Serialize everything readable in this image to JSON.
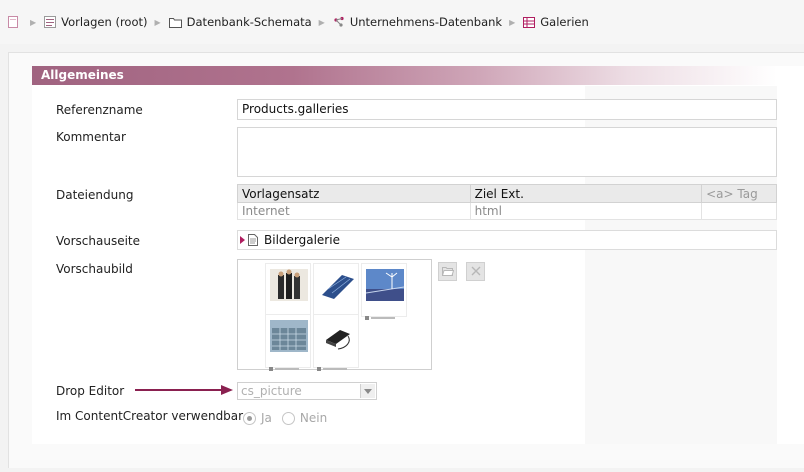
{
  "breadcrumb": {
    "items": [
      {
        "label": "Vorlagen (root)",
        "icon": "folder-template-icon"
      },
      {
        "label": "Datenbank-Schemata",
        "icon": "folder-icon"
      },
      {
        "label": "Unternehmens-Datenbank",
        "icon": "database-schema-icon"
      },
      {
        "label": "Galerien",
        "icon": "table-icon"
      }
    ]
  },
  "section": {
    "title": "Allgemeines"
  },
  "labels": {
    "referenzname": "Referenzname",
    "kommentar": "Kommentar",
    "dateiendung": "Dateiendung",
    "vorschauseite": "Vorschauseite",
    "vorschaubild": "Vorschaubild",
    "drop_editor": "Drop Editor",
    "im_contentcreator": "Im ContentCreator verwendbar"
  },
  "fields": {
    "referenzname": "Products.galleries",
    "kommentar": ""
  },
  "extensions_table": {
    "headers": [
      "Vorlagensatz",
      "Ziel Ext.",
      "<a> Tag"
    ],
    "rows": [
      [
        "Internet",
        "html",
        ""
      ]
    ]
  },
  "vorschauseite": {
    "value": "Bildergalerie"
  },
  "drop_editor": {
    "value": "cs_picture"
  },
  "contentcreator": {
    "option_yes": "Ja",
    "option_no": "Nein",
    "selected": "Ja"
  },
  "colors": {
    "accent": "#a06380",
    "arrow": "#8a2050"
  }
}
